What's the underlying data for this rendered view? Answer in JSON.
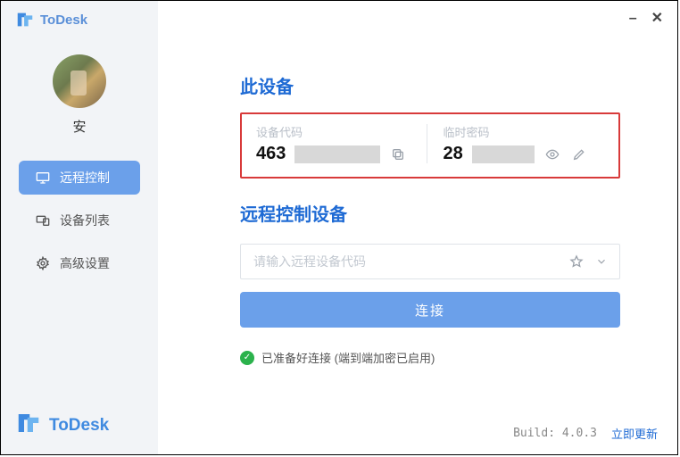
{
  "brand": {
    "name": "ToDesk"
  },
  "user": {
    "name": "安"
  },
  "nav": {
    "items": [
      {
        "key": "remote-control",
        "label": "远程控制",
        "active": true
      },
      {
        "key": "device-list",
        "label": "设备列表",
        "active": false
      },
      {
        "key": "advanced",
        "label": "高级设置",
        "active": false
      }
    ]
  },
  "this_device": {
    "title": "此设备",
    "code_label": "设备代码",
    "code_prefix": "463",
    "password_label": "临时密码",
    "password_prefix": "28"
  },
  "remote": {
    "title": "远程控制设备",
    "placeholder": "请输入远程设备代码",
    "connect_label": "连接"
  },
  "status": {
    "text": "已准备好连接 (端到端加密已启用)"
  },
  "footer": {
    "build": "Build: 4.0.3",
    "update": "立即更新"
  }
}
